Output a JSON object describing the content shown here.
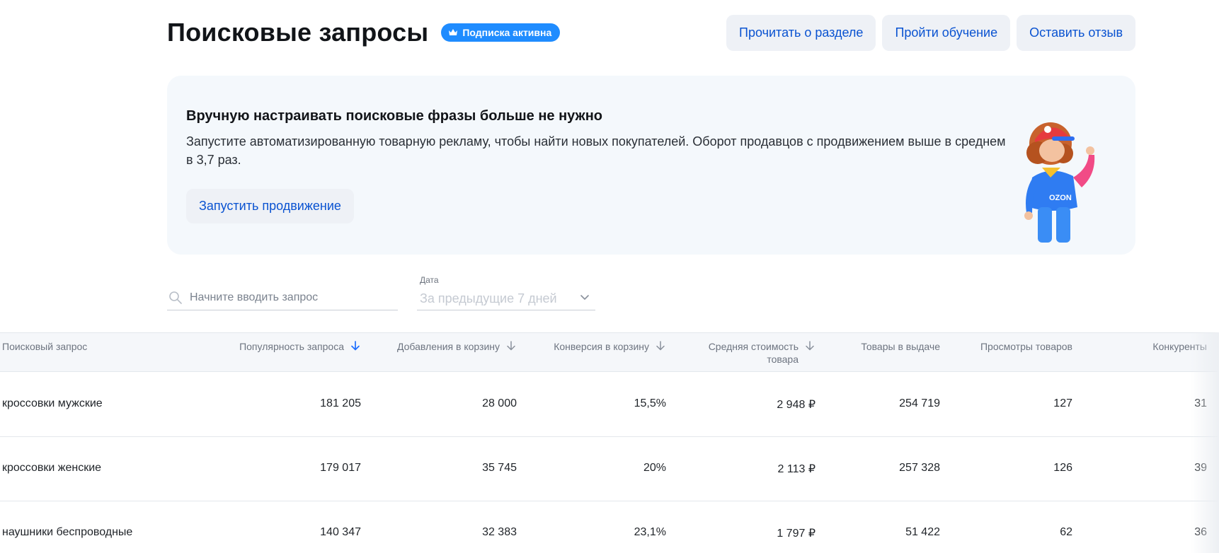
{
  "header": {
    "title": "Поисковые запросы",
    "badge": "Подписка активна",
    "actions": [
      "Прочитать о разделе",
      "Пройти обучение",
      "Оставить отзыв"
    ]
  },
  "promo": {
    "title": "Вручную настраивать поисковые фразы больше не нужно",
    "text": "Запустите автоматизированную товарную рекламу, чтобы найти новых покупателей. Оборот продавцов с продвижением выше в среднем в 3,7 раз.",
    "button": "Запустить продвижение",
    "mascot_text": "OZON"
  },
  "filters": {
    "search_placeholder": "Начните вводить запрос",
    "date_label": "Дата",
    "date_value": "За предыдущие 7 дней"
  },
  "table": {
    "columns": [
      "Поисковый запрос",
      "Популярность запроса",
      "Добавления в корзину",
      "Конверсия в корзину",
      "Средняя стоимость товара",
      "Товары в выдаче",
      "Просмотры товаров",
      "Конкуренты"
    ],
    "rows": [
      [
        "кроссовки мужские",
        "181 205",
        "28 000",
        "15,5%",
        "2 948 ₽",
        "254 719",
        "127",
        "31"
      ],
      [
        "кроссовки женские",
        "179 017",
        "35 745",
        "20%",
        "2 113 ₽",
        "257 328",
        "126",
        "39"
      ],
      [
        "наушники беспроводные",
        "140 347",
        "32 383",
        "23,1%",
        "1 797 ₽",
        "51 422",
        "62",
        "36"
      ]
    ]
  },
  "colors": {
    "accent": "#1f8cff",
    "link": "#0a53d1",
    "button_bg": "#eef1f6",
    "promo_bg": "#f4f8fc"
  }
}
